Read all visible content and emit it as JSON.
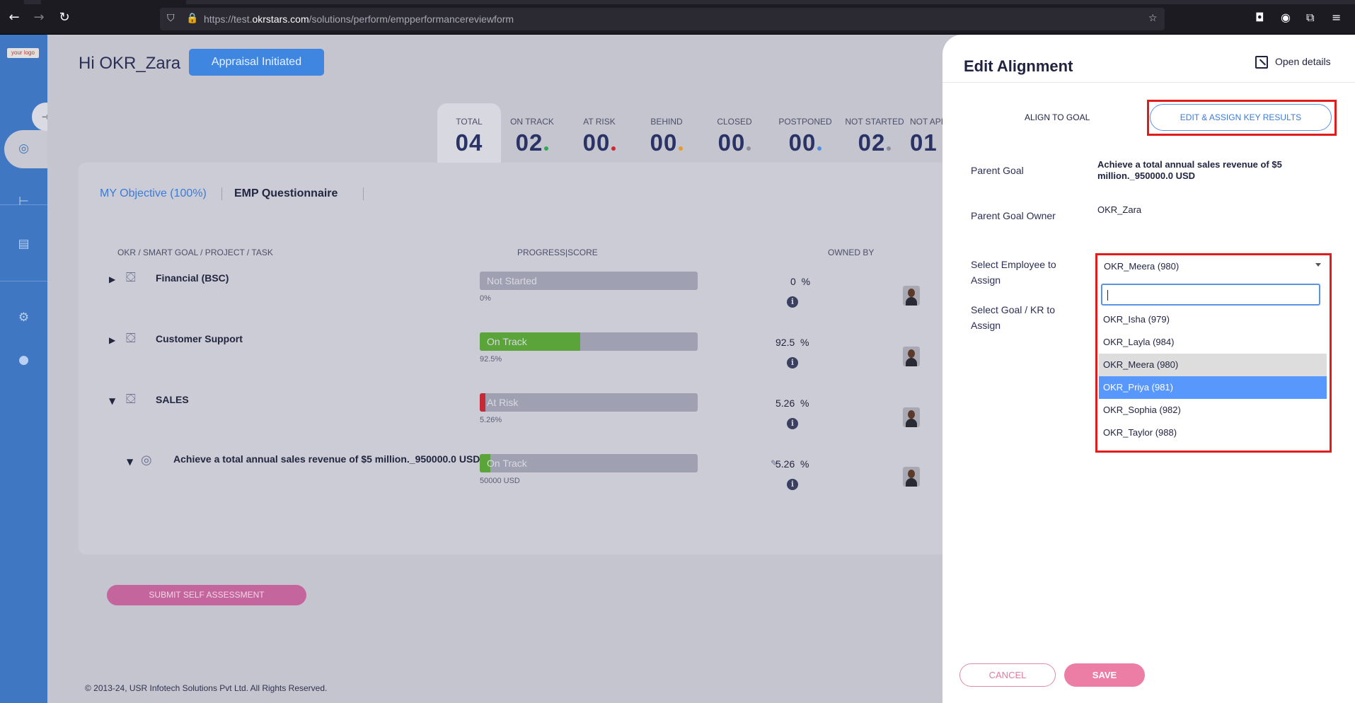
{
  "browser": {
    "url_prefix": "https://test.",
    "url_domain": "okrstars.com",
    "url_path": "/solutions/perform/empperformancereviewform"
  },
  "app": {
    "logo_text": "your logo",
    "greeting": "Hi OKR_Zara",
    "appraisal_status": "Appraisal Initiated"
  },
  "stats": [
    {
      "label": "TOTAL",
      "value": "04",
      "color": ""
    },
    {
      "label": "ON TRACK",
      "value": "02",
      "color": "#2eaa57"
    },
    {
      "label": "AT RISK",
      "value": "00",
      "color": "#d3262f"
    },
    {
      "label": "BEHIND",
      "value": "00",
      "color": "#e99a2c"
    },
    {
      "label": "CLOSED",
      "value": "00",
      "color": "#8c8e9c"
    },
    {
      "label": "POSTPONED",
      "value": "00",
      "color": "#4b8fe2"
    },
    {
      "label": "NOT STARTED",
      "value": "02",
      "color": "#8c8e9c"
    },
    {
      "label": "NOT API",
      "value": "01",
      "color": ""
    }
  ],
  "tabs": {
    "objective": "MY Objective (100%)",
    "questionnaire": "EMP Questionnaire"
  },
  "columns": {
    "task": "OKR / SMART GOAL / PROJECT / TASK",
    "progress": "PROGRESS|SCORE",
    "owner": "OWNED BY"
  },
  "rows": [
    {
      "title": "Financial (BSC)",
      "status": "Not Started",
      "progress": 0,
      "sub": "0%",
      "score": "0",
      "unit": "%",
      "fill_color": "#9fa1b2",
      "expanded": false
    },
    {
      "title": "Customer Support",
      "status": "On Track",
      "progress": 0.46,
      "sub": "92.5%",
      "score": "92.5",
      "unit": "%",
      "fill_color": "#5aa43a",
      "expanded": false
    },
    {
      "title": "SALES",
      "status": "At Risk",
      "progress": 0.026,
      "sub": "5.26%",
      "score": "5.26",
      "unit": "%",
      "fill_color": "#c62a35",
      "expanded": true
    },
    {
      "title": "Achieve a total annual sales revenue of $5 million._950000.0 USD",
      "status": "On Track",
      "progress": 0.05,
      "sub": "50000 USD",
      "score": "5.26",
      "unit": "%",
      "fill_color": "#5aa43a",
      "expanded": true
    }
  ],
  "submit_label": "SUBMIT SELF ASSESSMENT",
  "footer": "© 2013-24, USR Infotech Solutions Pvt Ltd. All Rights Reserved.",
  "drawer": {
    "title": "Edit Alignment",
    "open_details": "Open details",
    "tab_align": "ALIGN TO GOAL",
    "tab_edit": "EDIT & ASSIGN KEY RESULTS",
    "parent_goal_label": "Parent Goal",
    "parent_goal_value": "Achieve a total annual sales revenue of $5 million._950000.0 USD",
    "parent_owner_label": "Parent Goal Owner",
    "parent_owner_value": "OKR_Zara",
    "select_emp_label": "Select Employee to Assign",
    "select_goal_label": "Select Goal / KR to Assign",
    "selected_employee": "OKR_Meera (980)",
    "search_value": "",
    "options": [
      {
        "label": "OKR_Isha (979)",
        "state": ""
      },
      {
        "label": "OKR_Layla (984)",
        "state": ""
      },
      {
        "label": "OKR_Meera (980)",
        "state": "sel"
      },
      {
        "label": "OKR_Priya (981)",
        "state": "hov"
      },
      {
        "label": "OKR_Sophia (982)",
        "state": ""
      },
      {
        "label": "OKR_Taylor (988)",
        "state": ""
      }
    ],
    "cancel": "CANCEL",
    "save": "SAVE"
  }
}
